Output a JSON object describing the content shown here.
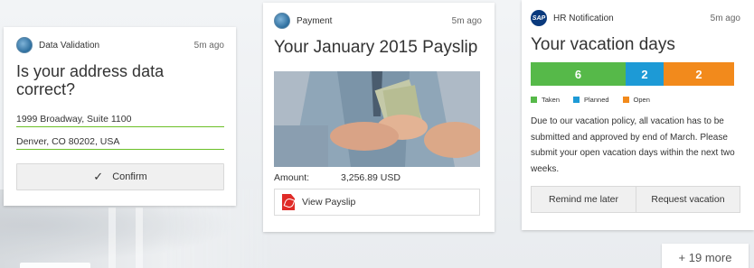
{
  "colors": {
    "accent_green": "#6bbf27",
    "taken": "#56b949",
    "planned": "#1d9ad6",
    "open": "#f28a1c"
  },
  "card_address": {
    "app_name": "Data Validation",
    "time": "5m ago",
    "title": "Is your address data correct?",
    "street": "1999 Broadway, Suite 1100",
    "city": "Denver, CO 80202, USA",
    "confirm_label": "Confirm",
    "icon": "globe-icon"
  },
  "card_payment": {
    "app_name": "Payment",
    "time": "5m ago",
    "title": "Your January 2015 Payslip",
    "amount_label": "Amount:",
    "amount_value": "3,256.89 USD",
    "view_label": "View Payslip",
    "icon": "globe-icon"
  },
  "card_hr": {
    "app_name": "HR Notification",
    "time": "5m ago",
    "title": "Your vacation days",
    "icon_text": "SAP",
    "vacation": {
      "taken": 6,
      "planned": 2,
      "open": 2
    },
    "legend": {
      "taken": "Taken",
      "planned": "Planned",
      "open": "Open"
    },
    "message": "Due to our vacation policy, all vacation has to be submitted and approved by end of March. Please submit your open vacation days within the next two weeks.",
    "remind_label": "Remind me later",
    "request_label": "Request vacation"
  },
  "more_label": "+ 19 more"
}
